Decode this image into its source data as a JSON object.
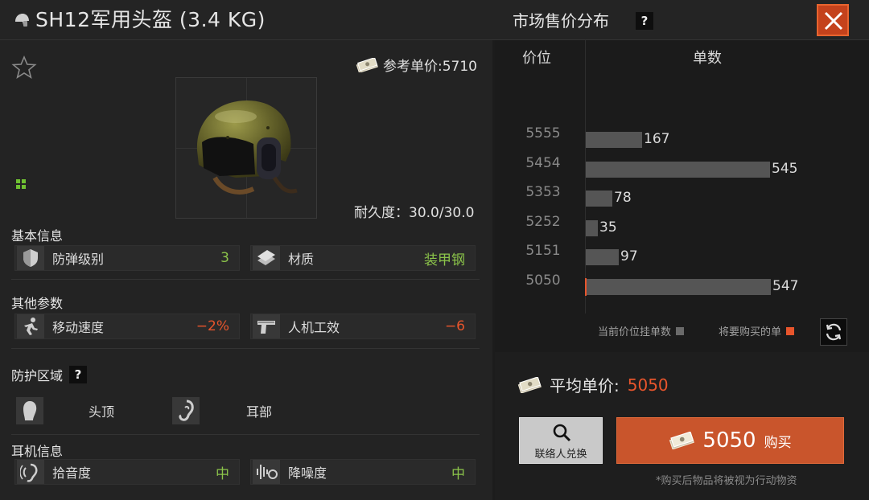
{
  "header": {
    "item_title": "SH12军用头盔 (3.4 KG)",
    "market_title": "市场售价分布",
    "help_symbol": "?",
    "close_icon": "close-icon"
  },
  "item": {
    "ref_price_label": "参考单价:5710",
    "durability": "耐久度：30.0/30.0",
    "grid_size": "2x2"
  },
  "sections": {
    "basic": "基本信息",
    "other": "其他参数",
    "protection": "防护区域",
    "headset": "耳机信息"
  },
  "stats": {
    "armor_class": {
      "label": "防弹级别",
      "value": "3",
      "icon": "shield-icon"
    },
    "material": {
      "label": "材质",
      "value": "装甲钢",
      "icon": "armor-plates-icon"
    },
    "move_speed": {
      "label": "移动速度",
      "value": "−2%",
      "icon": "running-man-icon"
    },
    "ergonomics": {
      "label": "人机工效",
      "value": "−6",
      "icon": "pistol-icon"
    },
    "pickup": {
      "label": "拾音度",
      "value": "中",
      "icon": "ear-sound-icon"
    },
    "noise_reduction": {
      "label": "降噪度",
      "value": "中",
      "icon": "noise-reduction-icon"
    }
  },
  "zones": {
    "head_top": {
      "label": "头顶",
      "icon": "head-icon"
    },
    "ears": {
      "label": "耳部",
      "icon": "ear-icon"
    }
  },
  "market": {
    "price_header": "价位",
    "count_header": "单数",
    "legend_current": "当前价位挂单数",
    "legend_buy": "将要购买的单",
    "avg_label": "平均单价:",
    "avg_value": "5050",
    "contact_label": "联络人兑换",
    "buy_price": "5050",
    "buy_label": "购买",
    "note": "*购买后物品将被视为行动物资",
    "colors": {
      "bar": "#555555",
      "buy": "#e8552c",
      "accent": "#c9552c"
    }
  },
  "chart_data": {
    "type": "bar",
    "orientation": "horizontal",
    "categories": [
      "5555",
      "5454",
      "5353",
      "5252",
      "5151",
      "5050"
    ],
    "values": [
      167,
      545,
      78,
      35,
      97,
      547
    ],
    "xlabel": "单数",
    "ylabel": "价位",
    "grid": false
  }
}
